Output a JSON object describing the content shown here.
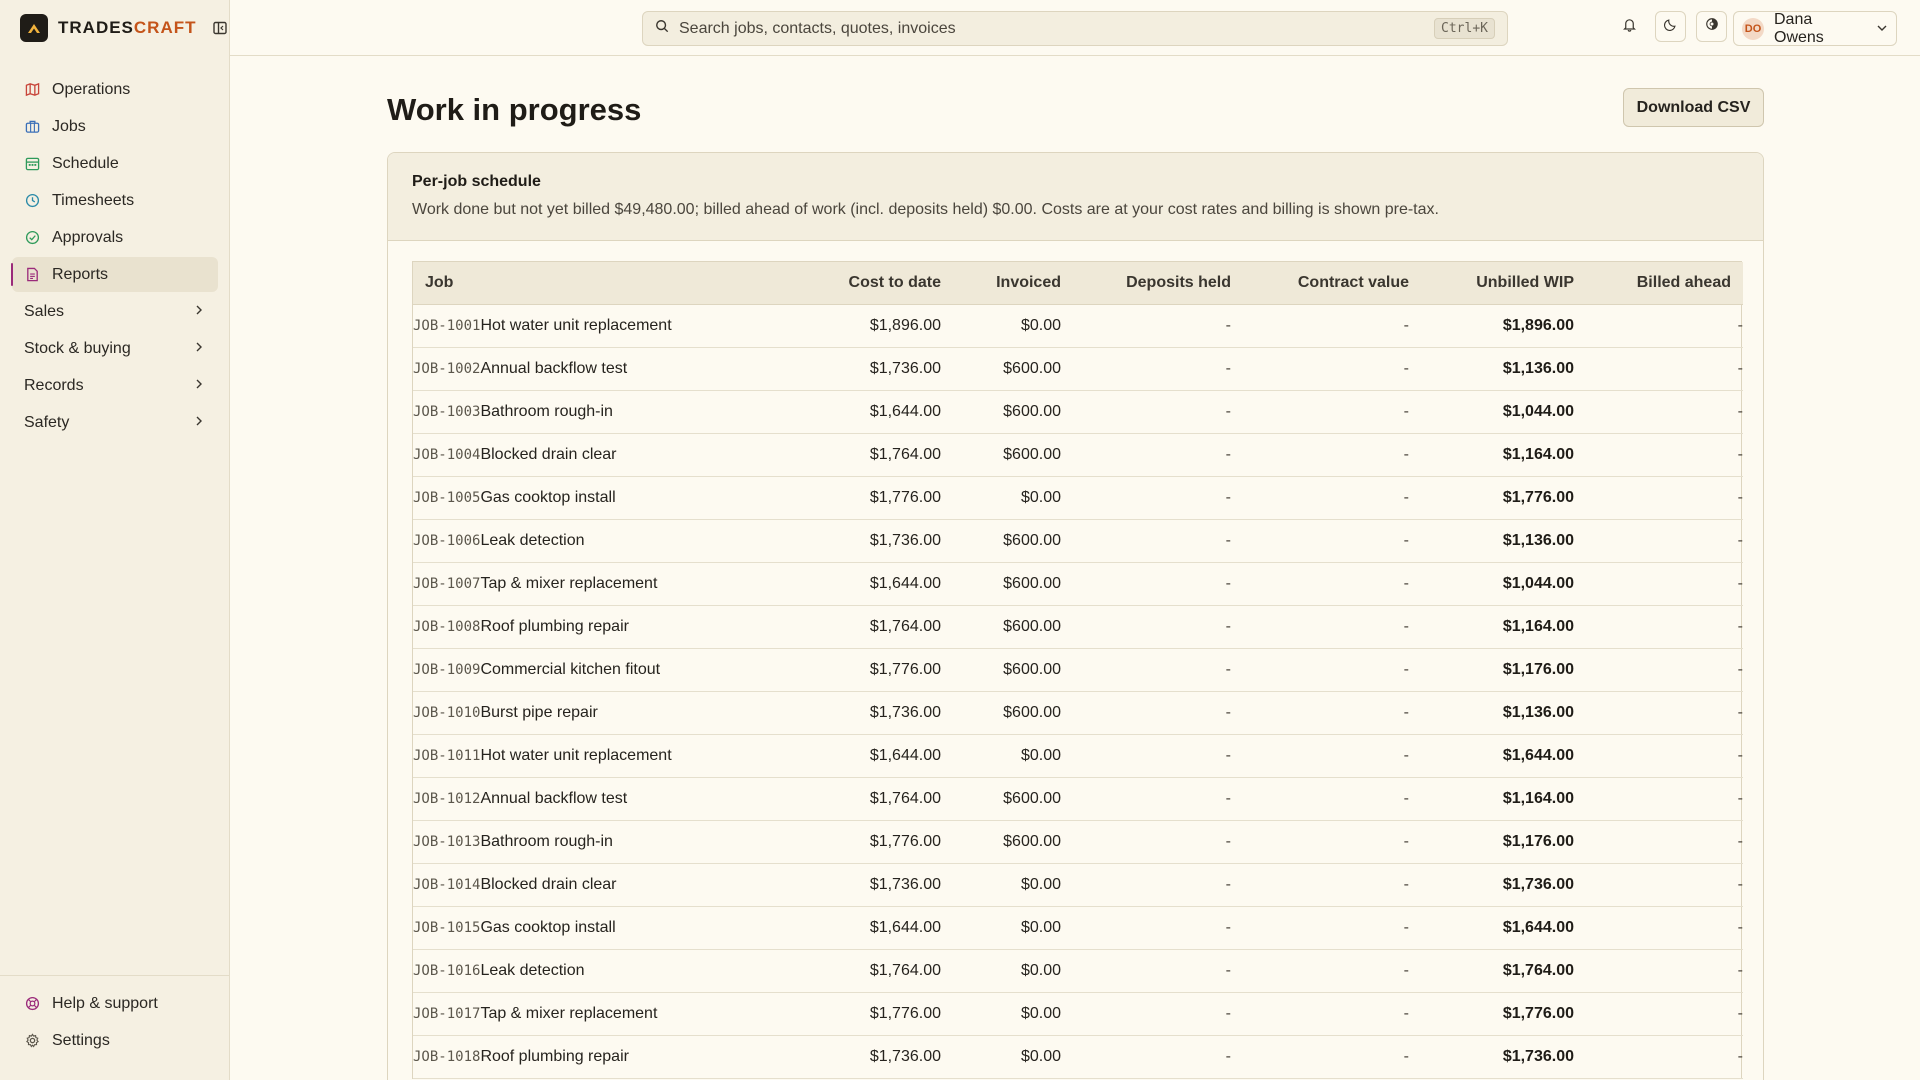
{
  "app": {
    "brand_prefix": "TRADES",
    "brand_accent": "CRAFT",
    "accent_color": "#c4541a"
  },
  "sidebar": {
    "items": [
      {
        "label": "Operations",
        "icon": "map-icon",
        "color": "#c8453a"
      },
      {
        "label": "Jobs",
        "icon": "briefcase-icon",
        "color": "#3a6fb8"
      },
      {
        "label": "Schedule",
        "icon": "calendar-icon",
        "color": "#2e9a5a"
      },
      {
        "label": "Timesheets",
        "icon": "clock-icon",
        "color": "#2a8aa8"
      },
      {
        "label": "Approvals",
        "icon": "check-circle-icon",
        "color": "#2e9a5a"
      },
      {
        "label": "Reports",
        "icon": "report-icon",
        "color": "#9a2a7a",
        "active": true
      }
    ],
    "groups": [
      {
        "label": "Sales"
      },
      {
        "label": "Stock & buying"
      },
      {
        "label": "Records"
      },
      {
        "label": "Safety"
      }
    ],
    "footer": [
      {
        "label": "Help & support",
        "icon": "help-icon",
        "color": "#9a2a7a"
      },
      {
        "label": "Settings",
        "icon": "gear-icon",
        "color": "#5c574c"
      }
    ]
  },
  "topbar": {
    "search_placeholder": "Search jobs, contacts, quotes, invoices",
    "shortcut": "Ctrl+K",
    "user_initials": "DO",
    "user_name": "Dana Owens"
  },
  "page": {
    "title": "Work in progress",
    "download_label": "Download CSV"
  },
  "schedule": {
    "title": "Per-job schedule",
    "subtitle": "Work done but not yet billed $49,480.00; billed ahead of work (incl. deposits held) $0.00. Costs are at your cost rates and billing is shown pre-tax.",
    "columns": [
      "Job",
      "Cost to date",
      "Invoiced",
      "Deposits held",
      "Contract value",
      "Unbilled WIP",
      "Billed ahead"
    ],
    "rows": [
      {
        "id": "JOB-1001",
        "name": "Hot water unit replacement",
        "cost": "$1,896.00",
        "invoiced": "$0.00",
        "deposits": "-",
        "contract": "-",
        "wip": "$1,896.00",
        "ahead": "-"
      },
      {
        "id": "JOB-1002",
        "name": "Annual backflow test",
        "cost": "$1,736.00",
        "invoiced": "$600.00",
        "deposits": "-",
        "contract": "-",
        "wip": "$1,136.00",
        "ahead": "-"
      },
      {
        "id": "JOB-1003",
        "name": "Bathroom rough-in",
        "cost": "$1,644.00",
        "invoiced": "$600.00",
        "deposits": "-",
        "contract": "-",
        "wip": "$1,044.00",
        "ahead": "-"
      },
      {
        "id": "JOB-1004",
        "name": "Blocked drain clear",
        "cost": "$1,764.00",
        "invoiced": "$600.00",
        "deposits": "-",
        "contract": "-",
        "wip": "$1,164.00",
        "ahead": "-"
      },
      {
        "id": "JOB-1005",
        "name": "Gas cooktop install",
        "cost": "$1,776.00",
        "invoiced": "$0.00",
        "deposits": "-",
        "contract": "-",
        "wip": "$1,776.00",
        "ahead": "-"
      },
      {
        "id": "JOB-1006",
        "name": "Leak detection",
        "cost": "$1,736.00",
        "invoiced": "$600.00",
        "deposits": "-",
        "contract": "-",
        "wip": "$1,136.00",
        "ahead": "-"
      },
      {
        "id": "JOB-1007",
        "name": "Tap & mixer replacement",
        "cost": "$1,644.00",
        "invoiced": "$600.00",
        "deposits": "-",
        "contract": "-",
        "wip": "$1,044.00",
        "ahead": "-"
      },
      {
        "id": "JOB-1008",
        "name": "Roof plumbing repair",
        "cost": "$1,764.00",
        "invoiced": "$600.00",
        "deposits": "-",
        "contract": "-",
        "wip": "$1,164.00",
        "ahead": "-"
      },
      {
        "id": "JOB-1009",
        "name": "Commercial kitchen fitout",
        "cost": "$1,776.00",
        "invoiced": "$600.00",
        "deposits": "-",
        "contract": "-",
        "wip": "$1,176.00",
        "ahead": "-"
      },
      {
        "id": "JOB-1010",
        "name": "Burst pipe repair",
        "cost": "$1,736.00",
        "invoiced": "$600.00",
        "deposits": "-",
        "contract": "-",
        "wip": "$1,136.00",
        "ahead": "-"
      },
      {
        "id": "JOB-1011",
        "name": "Hot water unit replacement",
        "cost": "$1,644.00",
        "invoiced": "$0.00",
        "deposits": "-",
        "contract": "-",
        "wip": "$1,644.00",
        "ahead": "-"
      },
      {
        "id": "JOB-1012",
        "name": "Annual backflow test",
        "cost": "$1,764.00",
        "invoiced": "$600.00",
        "deposits": "-",
        "contract": "-",
        "wip": "$1,164.00",
        "ahead": "-"
      },
      {
        "id": "JOB-1013",
        "name": "Bathroom rough-in",
        "cost": "$1,776.00",
        "invoiced": "$600.00",
        "deposits": "-",
        "contract": "-",
        "wip": "$1,176.00",
        "ahead": "-"
      },
      {
        "id": "JOB-1014",
        "name": "Blocked drain clear",
        "cost": "$1,736.00",
        "invoiced": "$0.00",
        "deposits": "-",
        "contract": "-",
        "wip": "$1,736.00",
        "ahead": "-"
      },
      {
        "id": "JOB-1015",
        "name": "Gas cooktop install",
        "cost": "$1,644.00",
        "invoiced": "$0.00",
        "deposits": "-",
        "contract": "-",
        "wip": "$1,644.00",
        "ahead": "-"
      },
      {
        "id": "JOB-1016",
        "name": "Leak detection",
        "cost": "$1,764.00",
        "invoiced": "$0.00",
        "deposits": "-",
        "contract": "-",
        "wip": "$1,764.00",
        "ahead": "-"
      },
      {
        "id": "JOB-1017",
        "name": "Tap & mixer replacement",
        "cost": "$1,776.00",
        "invoiced": "$0.00",
        "deposits": "-",
        "contract": "-",
        "wip": "$1,776.00",
        "ahead": "-"
      },
      {
        "id": "JOB-1018",
        "name": "Roof plumbing repair",
        "cost": "$1,736.00",
        "invoiced": "$0.00",
        "deposits": "-",
        "contract": "-",
        "wip": "$1,736.00",
        "ahead": "-"
      }
    ]
  }
}
